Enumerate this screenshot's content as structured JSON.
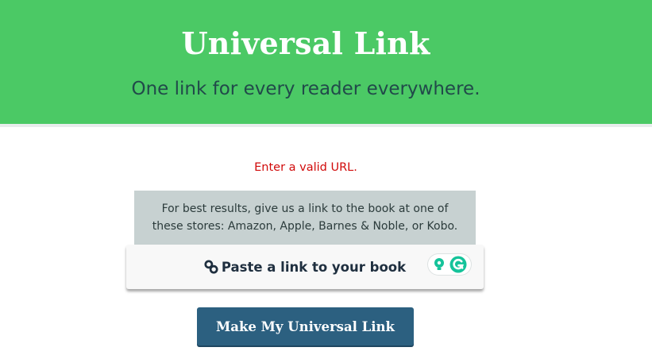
{
  "hero": {
    "title": "Universal Link",
    "subtitle": "One link for every reader everywhere."
  },
  "form": {
    "error_message": "Enter a valid URL.",
    "hint_line1": "For best results, give us a link to the book at one of",
    "hint_line2": "these stores: Amazon, Apple, Barnes & Noble, or Kobo.",
    "input_placeholder": "Paste a link to your book",
    "input_value": "",
    "submit_label": "Make My Universal Link",
    "icons": {
      "input_icon": "link-icon",
      "extension_icons": [
        "lightbulb-icon",
        "grammarly-icon"
      ]
    }
  },
  "colors": {
    "hero_bg": "#4bc965",
    "hero_title": "#ffffff",
    "hero_subtitle": "#214a4a",
    "error": "#d10a0a",
    "hint_bg": "#c7d1d1",
    "button_bg": "#2c6080",
    "grammarly_green": "#15c39a"
  }
}
